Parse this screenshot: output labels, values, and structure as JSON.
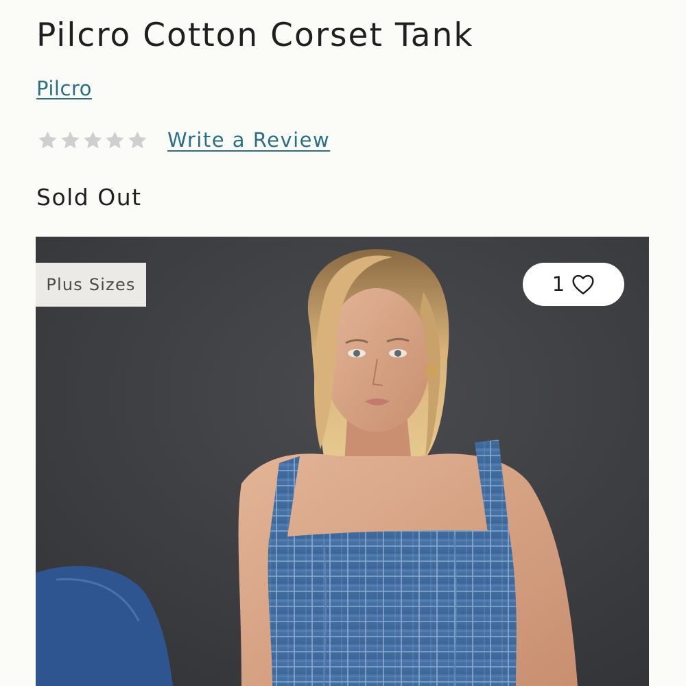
{
  "product": {
    "title": "Pilcro Cotton Corset Tank",
    "brand": "Pilcro",
    "rating": {
      "stars_filled": 0,
      "stars_total": 5,
      "write_review_label": "Write a Review"
    },
    "availability": "Sold Out"
  },
  "image": {
    "badge_label": "Plus Sizes",
    "wishlist_count": "1"
  },
  "icons": {
    "star": "star-icon",
    "heart": "heart-icon"
  },
  "colors": {
    "link": "#2b6f86",
    "star_empty": "#cfcfcf",
    "background": "#fbfbf8",
    "image_backdrop": "#3c3d40"
  }
}
